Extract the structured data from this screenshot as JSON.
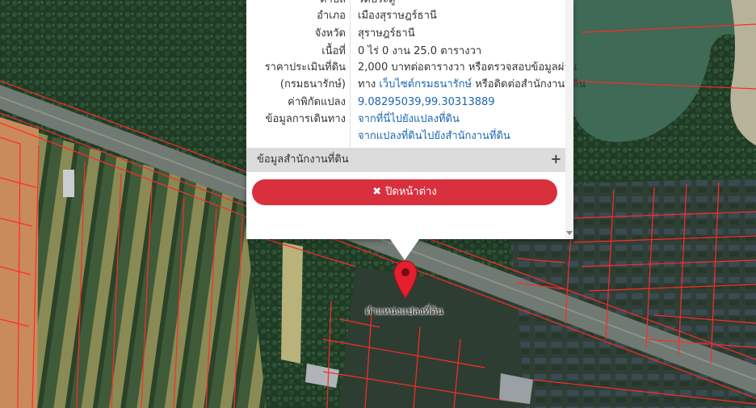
{
  "popup": {
    "rows": [
      {
        "label": "ตำบล",
        "value": "วัดประดู่"
      },
      {
        "label": "อำเภอ",
        "value": "เมืองสุราษฎร์ธานี"
      },
      {
        "label": "จังหวัด",
        "value": "สุราษฎร์ธานี"
      },
      {
        "label": "เนื้อที่",
        "value": "0 ไร่ 0 งาน 25.0 ตารางวา"
      }
    ],
    "price": {
      "label": "ราคาประเมินที่ดิน",
      "label2": "(กรมธนารักษ์)",
      "text1": "2,000 บาทต่อตารางวา หรือตรวจสอบข้อมูลผ่าน",
      "text2_pre": "ทาง ",
      "link": "เว็บไซต์กรมธนารักษ์",
      "text2_post": " หรือติดต่อสำนักงานที่ดิน"
    },
    "coords": {
      "label": "ค่าพิกัดแปลง",
      "value": "9.08295039,99.30313889"
    },
    "directions": {
      "label": "ข้อมูลการเดินทาง",
      "link1": "จากที่นี่ไปยังแปลงที่ดิน",
      "link2": "จากแปลงที่ดินไปยังสำนักงานที่ดิน"
    },
    "office_section": "ข้อมูลสำนักงานที่ดิน",
    "expand_symbol": "+",
    "close_label": "ปิดหน้าต่าง",
    "close_symbol": "✖"
  },
  "marker": {
    "label": "ตำแหน่งแปลงที่ดิน",
    "color": "#e3202d"
  },
  "colors": {
    "parcel_line": "#ff2a2a",
    "popup_button": "#d9303e",
    "link": "#1a66b3"
  }
}
